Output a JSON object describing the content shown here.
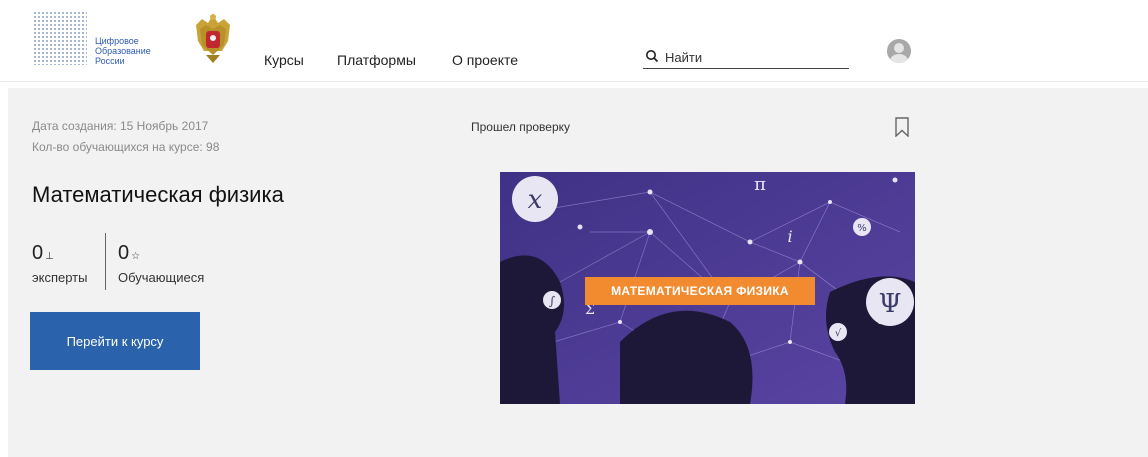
{
  "header": {
    "logo_lines": [
      "Цифровое",
      "Образование",
      "России"
    ],
    "nav": [
      {
        "label": "Курсы"
      },
      {
        "label": "Платформы"
      },
      {
        "label": "О проекте"
      }
    ],
    "search": {
      "placeholder": "Найти"
    }
  },
  "course": {
    "created": "Дата создания: 15 Ноябрь 2017",
    "students_count": "Кол-во обучающихся на курсе: 98",
    "verified": "Прошел проверку",
    "title": "Математическая физика",
    "stats": {
      "experts_value": "0",
      "experts_label": "эксперты",
      "learners_value": "0",
      "learners_label": "Обучающиеся"
    },
    "go_button": "Перейти к курсу",
    "image_banner": "МАТЕМАТИЧЕСКАЯ ФИЗИКА",
    "image_symbols": [
      "𝑥",
      "π",
      "Ψ",
      "∫",
      "Σ",
      "i",
      "%",
      "√"
    ]
  },
  "colors": {
    "accent": "#2a63ab",
    "banner": "#f28a30",
    "image_bg": "#4a3a8c"
  }
}
